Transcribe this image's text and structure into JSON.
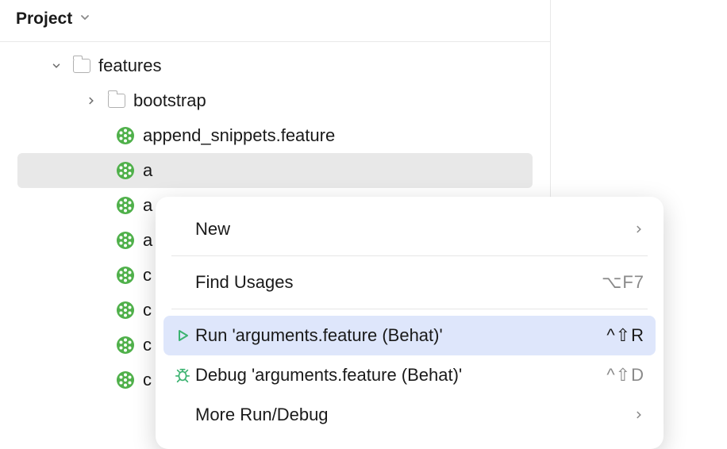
{
  "panel": {
    "title": "Project"
  },
  "tree": {
    "items": [
      {
        "label": "features",
        "type": "folder",
        "expanded": true,
        "indent": 1
      },
      {
        "label": "bootstrap",
        "type": "folder",
        "expanded": false,
        "indent": 2
      },
      {
        "label": "append_snippets.feature",
        "type": "feature",
        "indent": 3
      },
      {
        "label": "a",
        "type": "feature",
        "indent": 3,
        "selected": true
      },
      {
        "label": "a",
        "type": "feature",
        "indent": 3
      },
      {
        "label": "a",
        "type": "feature",
        "indent": 3
      },
      {
        "label": "c",
        "type": "feature",
        "indent": 3
      },
      {
        "label": "c",
        "type": "feature",
        "indent": 3
      },
      {
        "label": "c",
        "type": "feature",
        "indent": 3
      },
      {
        "label": "c",
        "type": "feature",
        "indent": 3
      }
    ]
  },
  "contextMenu": {
    "items": [
      {
        "label": "New",
        "shortcut": "",
        "hasSubmenu": true
      },
      {
        "type": "separator"
      },
      {
        "label": "Find Usages",
        "shortcut": "⌥F7"
      },
      {
        "type": "separator"
      },
      {
        "label": "Run 'arguments.feature (Behat)'",
        "shortcut": "^⇧R",
        "icon": "run",
        "highlighted": true
      },
      {
        "label": "Debug 'arguments.feature (Behat)'",
        "shortcut": "^⇧D",
        "icon": "debug"
      },
      {
        "label": "More Run/Debug",
        "shortcut": "",
        "hasSubmenu": true
      }
    ]
  }
}
